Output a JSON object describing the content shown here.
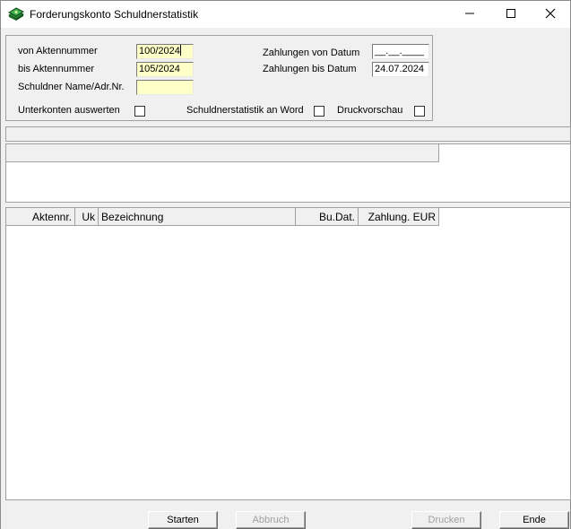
{
  "window": {
    "title": "Forderungskonto Schuldnerstatistik",
    "app_icon": "money-stack-icon",
    "controls": {
      "minimize": "minimize-icon",
      "maximize": "maximize-icon",
      "close": "close-icon"
    }
  },
  "filters": {
    "von_aktennummer": {
      "label": "von Aktennummer",
      "value": "100/2024"
    },
    "bis_aktennummer": {
      "label": "bis Aktennummer",
      "value": "105/2024"
    },
    "schuldner": {
      "label": "Schuldner Name/Adr.Nr.",
      "value": ""
    },
    "zahlungen_von": {
      "label": "Zahlungen von Datum",
      "value": "__.__.____"
    },
    "zahlungen_bis": {
      "label": "Zahlungen bis Datum",
      "value": "24.07.2024"
    },
    "unterkonten": {
      "label": "Unterkonten auswerten",
      "checked": false
    },
    "an_word": {
      "label": "Schuldnerstatistik an Word",
      "checked": false
    },
    "druckvorschau": {
      "label": "Druckvorschau",
      "checked": false
    }
  },
  "grid": {
    "columns": [
      "Aktennr.",
      "Uk",
      "Bezeichnung",
      "Bu.Dat.",
      "Zahlung. EUR"
    ],
    "rows": []
  },
  "footer": {
    "starten": {
      "label": "Starten",
      "enabled": true
    },
    "abbruch": {
      "label": "Abbruch",
      "enabled": false
    },
    "drucken": {
      "label": "Drucken",
      "enabled": false
    },
    "ende": {
      "label": "Ende",
      "enabled": true
    }
  },
  "colors": {
    "input_highlight": "#ffffc8",
    "window_bg": "#f0f0f0",
    "disabled_text": "#a0a0a0"
  }
}
